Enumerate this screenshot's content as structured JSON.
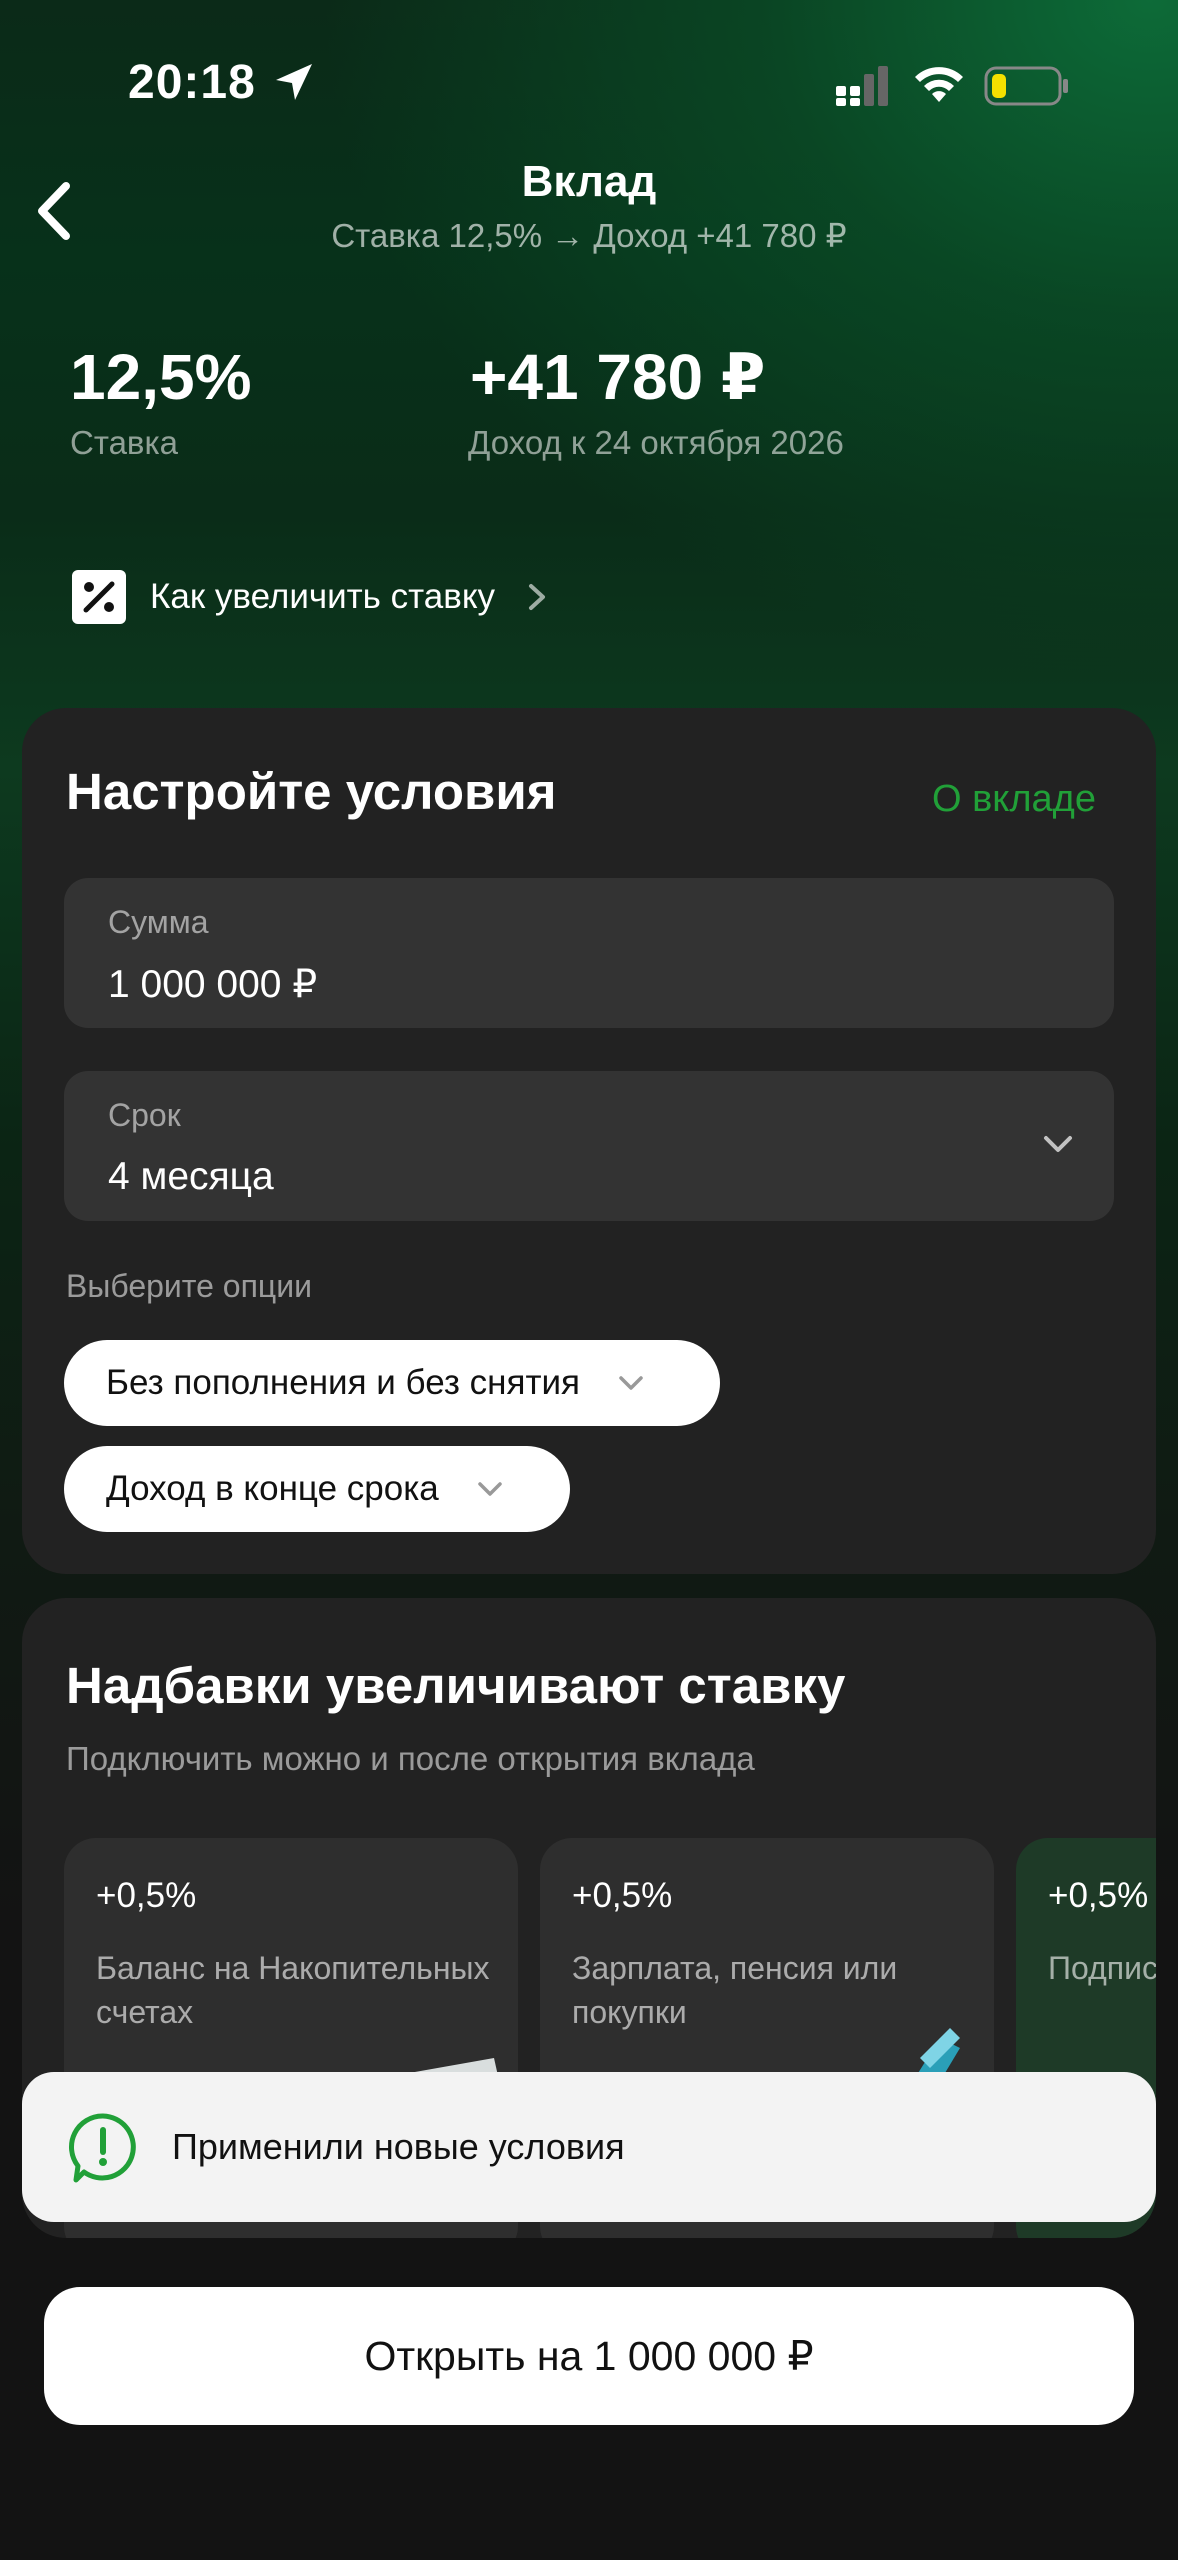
{
  "status_bar": {
    "time": "20:18"
  },
  "header": {
    "title": "Вклад",
    "subtitle": "Ставка 12,5% → Доход +41 780 ₽"
  },
  "stats": {
    "rate_value": "12,5%",
    "rate_label": "Ставка",
    "income_value": "+41 780 ₽",
    "income_label": "Доход к 24 октября 2026"
  },
  "how_to_increase": {
    "label": "Как увеличить ставку"
  },
  "conditions": {
    "title": "Настройте условия",
    "about_link": "О вкладе",
    "amount": {
      "label": "Сумма",
      "value": "1 000 000 ₽"
    },
    "term": {
      "label": "Срок",
      "value": "4 месяца"
    },
    "options_label": "Выберите опции",
    "options": [
      "Без пополнения и без снятия",
      "Доход в конце срока"
    ]
  },
  "bonuses": {
    "title": "Надбавки увеличивают ставку",
    "subtitle": "Подключить можно и после открытия вклада",
    "items": [
      {
        "pct": "+0,5%",
        "text": "Баланс на Накопительных счетах"
      },
      {
        "pct": "+0,5%",
        "text": "Зарплата, пенсия или покупки"
      },
      {
        "pct": "+0,5%",
        "text": "Подпис"
      }
    ]
  },
  "toast": {
    "text": "Применили новые условия"
  },
  "cta": {
    "label": "Открыть на 1 000 000 ₽"
  },
  "colors": {
    "accent_green": "#21a038",
    "battery_fill": "#f5e000"
  },
  "icons": [
    "location-arrow-icon",
    "signal-icon",
    "wifi-icon",
    "battery-icon",
    "back-chevron-icon",
    "percent-icon",
    "chevron-right-icon",
    "chevron-down-icon",
    "alert-message-icon"
  ]
}
